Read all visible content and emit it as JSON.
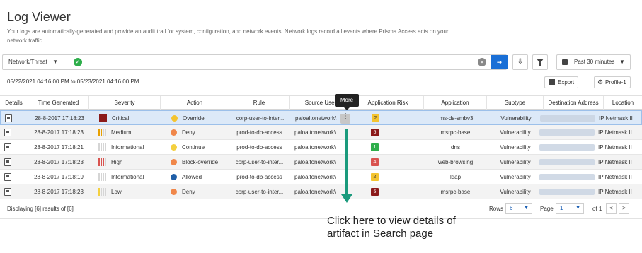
{
  "header": {
    "title": "Log Viewer",
    "subtitle": "Your  logs are automatically-generated and provide an audit trail for system, configuration, and network events. Network logs record all events where Prisma Access acts on your network traffic"
  },
  "filter": {
    "type_label": "Network/Threat",
    "query_value": "",
    "time_range": "Past 30 minutes"
  },
  "date_range": "05/22/2021 04:16.00 PM to 05/23/2021 04:16.00 PM",
  "actions": {
    "export_label": "Export",
    "profile_label": "Profile-1"
  },
  "tooltip": "More",
  "columns": [
    "Details",
    "Time Generated",
    "Severity",
    "Action",
    "Rule",
    "Source User",
    "Application Risk",
    "Application",
    "Subtype",
    "Destination Address",
    "Location"
  ],
  "rows": [
    {
      "time": "28-8-2017 17:18:23",
      "severity": "Critical",
      "sev_color": "#8b1a1a",
      "sev_bars": 4,
      "action": "Override",
      "action_color": "#f4c430",
      "rule": "corp-user-to-inter...",
      "source_user": "paloaltonetwork\\",
      "risk": "2",
      "risk_color": "#f4c430",
      "risk_text": "#333",
      "application": "ms-ds-smbv3",
      "subtype": "Vulnerability",
      "location": "IP Netmask II"
    },
    {
      "time": "28-8-2017 17:18:23",
      "severity": "Medium",
      "sev_color": "#e8a000",
      "sev_bars": 2,
      "action": "Deny",
      "action_color": "#f0874a",
      "rule": "prod-to-db-access",
      "source_user": "paloaltonetwork\\",
      "risk": "5",
      "risk_color": "#8b1a1a",
      "risk_text": "#fff",
      "application": "msrpc-base",
      "subtype": "Vulnerability",
      "location": "IP Netmask II"
    },
    {
      "time": "28-8-2017 17:18:21",
      "severity": "Informational",
      "sev_color": "#bbbbbb",
      "sev_bars": 0,
      "action": "Continue",
      "action_color": "#f4d03f",
      "rule": "prod-to-db-access",
      "source_user": "paloaltonetwork\\",
      "risk": "1",
      "risk_color": "#2eae4b",
      "risk_text": "#fff",
      "application": "dns",
      "subtype": "Vulnerability",
      "location": "IP Netmask II"
    },
    {
      "time": "28-8-2017 17:18:23",
      "severity": "High",
      "sev_color": "#d9534f",
      "sev_bars": 3,
      "action": "Block-override",
      "action_color": "#f0874a",
      "rule": "corp-user-to-inter...",
      "source_user": "paloaltonetwork\\",
      "risk": "4",
      "risk_color": "#d9534f",
      "risk_text": "#fff",
      "application": "web-browsing",
      "subtype": "Vulnerability",
      "location": "IP Netmask II"
    },
    {
      "time": "28-8-2017 17:18:19",
      "severity": "Informational",
      "sev_color": "#bbbbbb",
      "sev_bars": 0,
      "action": "Allowed",
      "action_color": "#1f5fa8",
      "rule": "prod-to-db-access",
      "source_user": "paloaltonetwork\\",
      "risk": "2",
      "risk_color": "#f4c430",
      "risk_text": "#333",
      "application": "ldap",
      "subtype": "Vulnerability",
      "location": "IP Netmask II"
    },
    {
      "time": "28-8-2017 17:18:23",
      "severity": "Low",
      "sev_color": "#f4d03f",
      "sev_bars": 1,
      "action": "Deny",
      "action_color": "#f0874a",
      "rule": "corp-user-to-inter...",
      "source_user": "paloaltonetwork\\",
      "risk": "5",
      "risk_color": "#8b1a1a",
      "risk_text": "#fff",
      "application": "msrpc-base",
      "subtype": "Vulnerability",
      "location": "IP Netmask II"
    }
  ],
  "footer": {
    "displaying": "Displaying [6] results of [6]",
    "rows_label": "Rows",
    "rows_value": "6",
    "page_label": "Page",
    "page_value": "1",
    "of_label": "of 1",
    "prev": "<",
    "next": ">"
  },
  "callout": "Click here to view details of artifact in Search page",
  "colors": {
    "accent": "#1a6fd6",
    "arrow": "#1a9a7c",
    "selected_row": "#dce9f8"
  }
}
